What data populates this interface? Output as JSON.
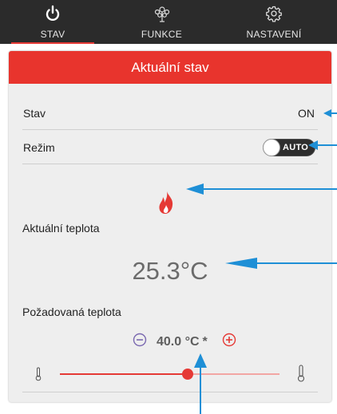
{
  "nav": {
    "tabs": [
      {
        "label": "STAV",
        "icon": "power-icon",
        "active": true
      },
      {
        "label": "FUNKCE",
        "icon": "function-tree-icon",
        "active": false
      },
      {
        "label": "NASTAVENÍ",
        "icon": "gear-icon",
        "active": false
      }
    ]
  },
  "panel": {
    "title": "Aktuální stav",
    "stav": {
      "label": "Stav",
      "value": "ON"
    },
    "rezim": {
      "label": "Režim",
      "toggle_text": "AUTO"
    },
    "status_icon": "flame-icon",
    "aktualni": {
      "label": "Aktuální teplota",
      "value": "25.3°C"
    },
    "pozadovana": {
      "label": "Požadovaná teplota",
      "value": "40.0 °C",
      "marker": "*",
      "slider_fraction": 0.58
    }
  },
  "colors": {
    "nav_bg": "#2b2b2b",
    "accent": "#e53935",
    "header_bg": "#e8342d",
    "panel_bg": "#eeeeee",
    "annotation_arrow": "#1e8fd6",
    "minus_color": "#7a68b0"
  }
}
